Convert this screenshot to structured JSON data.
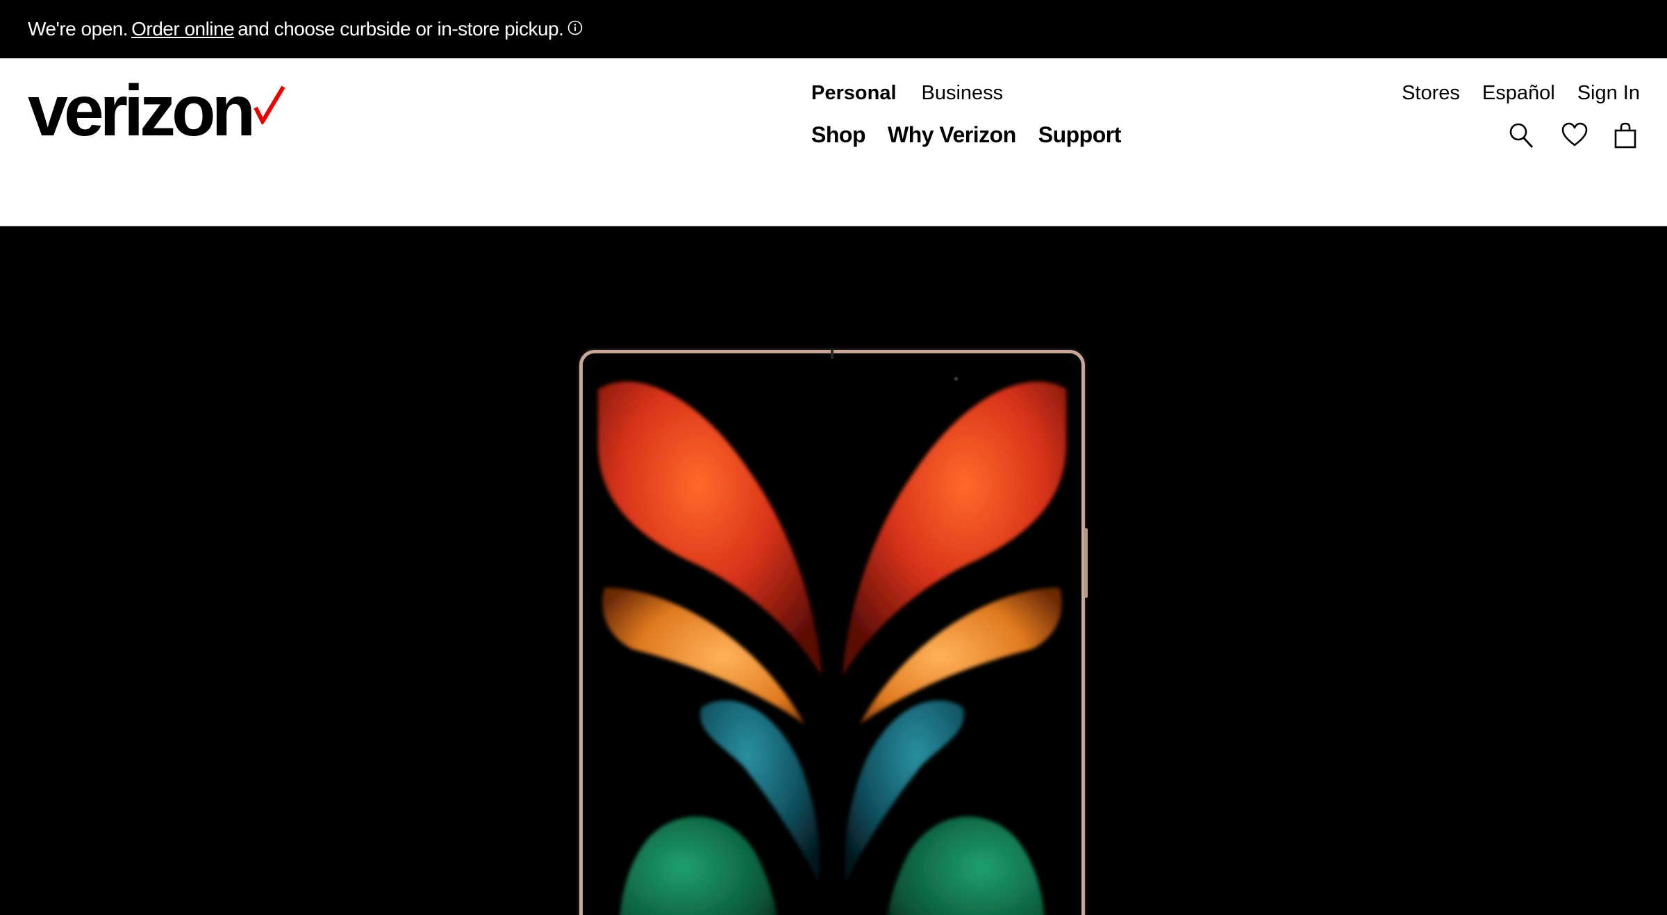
{
  "announcement": {
    "prefix": "We're open.",
    "link": "Order online",
    "suffix": "and choose curbside or in-store pickup.",
    "icon": "info-icon"
  },
  "brand": {
    "name": "verizon",
    "accent_color": "#ee0000"
  },
  "nav": {
    "segments": [
      "Personal",
      "Business"
    ],
    "active_segment": "Personal",
    "main": [
      "Shop",
      "Why Verizon",
      "Support"
    ]
  },
  "utility": {
    "links": [
      "Stores",
      "Español",
      "Sign In"
    ],
    "icons": [
      "search-icon",
      "heart-icon",
      "bag-icon"
    ]
  },
  "hero": {
    "image": "folding-phone-butterfly-wallpaper"
  }
}
